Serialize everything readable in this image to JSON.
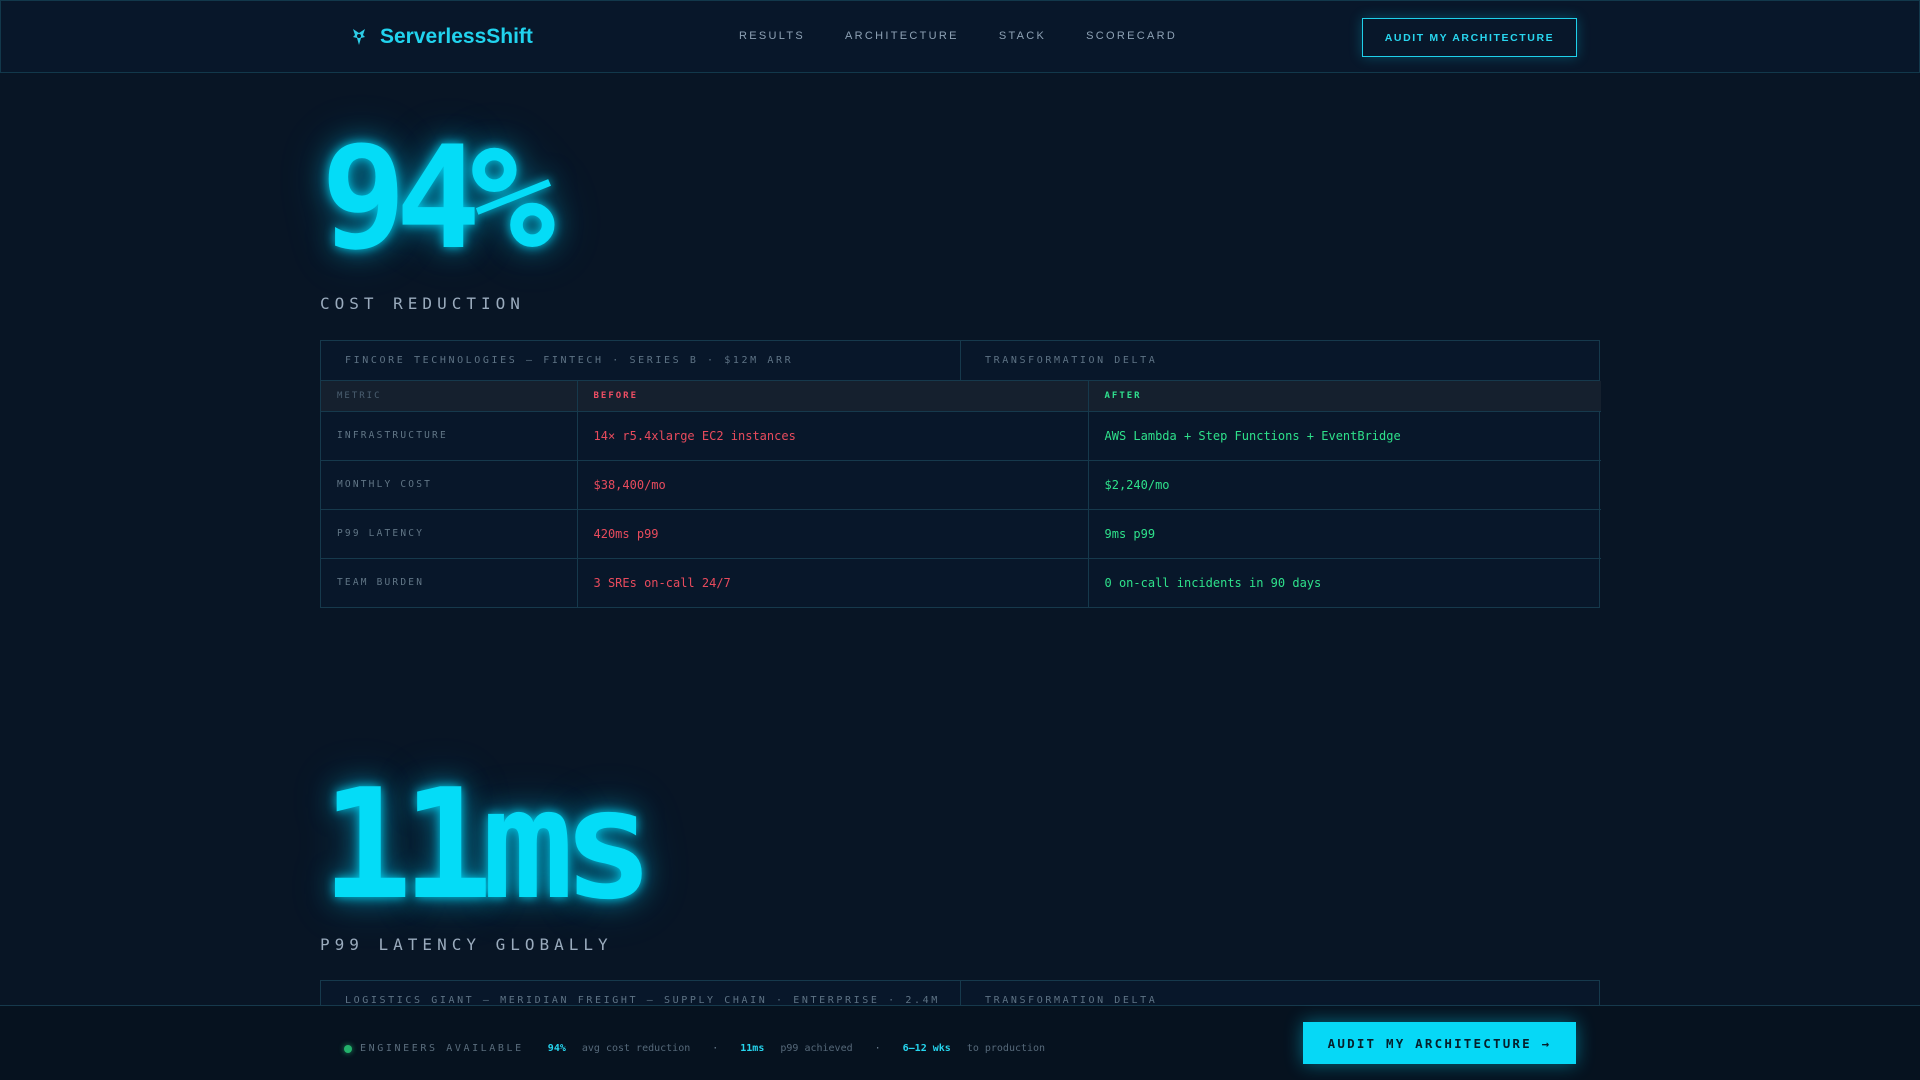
{
  "brand": {
    "name": "ServerlessShift",
    "icon": "lambda-shield-icon"
  },
  "nav": {
    "items": [
      {
        "label": "RESULTS"
      },
      {
        "label": "ARCHITECTURE"
      },
      {
        "label": "STACK"
      },
      {
        "label": "SCORECARD"
      }
    ],
    "cta_label": "AUDIT MY ARCHITECTURE"
  },
  "cases": [
    {
      "stat": "94%",
      "stat_label": "COST REDUCTION",
      "client": "FINCORE TECHNOLOGIES — FINTECH · SERIES B · $12M ARR",
      "delta_label": "TRANSFORMATION DELTA",
      "headers": {
        "metric": "METRIC",
        "before": "BEFORE",
        "after": "AFTER"
      },
      "rows": [
        {
          "metric": "INFRASTRUCTURE",
          "before": "14× r5.4xlarge EC2 instances",
          "after": "AWS Lambda + Step Functions + EventBridge"
        },
        {
          "metric": "MONTHLY COST",
          "before": "$38,400/mo",
          "after": "$2,240/mo"
        },
        {
          "metric": "P99 LATENCY",
          "before": "420ms p99",
          "after": "9ms p99"
        },
        {
          "metric": "TEAM BURDEN",
          "before": "3 SREs on-call 24/7",
          "after": "0 on-call incidents in 90 days"
        }
      ]
    },
    {
      "stat": "11ms",
      "stat_label": "P99 LATENCY GLOBALLY",
      "client": "LOGISTICS GIANT — MERIDIAN FREIGHT — SUPPLY CHAIN · ENTERPRISE · 2.4M",
      "delta_label": "TRANSFORMATION DELTA"
    }
  ],
  "bottom_bar": {
    "status_label": "ENGINEERS AVAILABLE",
    "stats": [
      {
        "value": "94%",
        "text": "avg cost reduction"
      },
      {
        "value": "11ms",
        "text": "p99 achieved"
      },
      {
        "value": "6–12 wks",
        "text": "to production"
      }
    ],
    "separator": "·",
    "cta_label": "AUDIT MY ARCHITECTURE →"
  },
  "colors": {
    "background": "#081525",
    "accent": "#04dcf7",
    "before": "#e84b5d",
    "after": "#2ee18b",
    "status_dot": "#23b26b"
  }
}
